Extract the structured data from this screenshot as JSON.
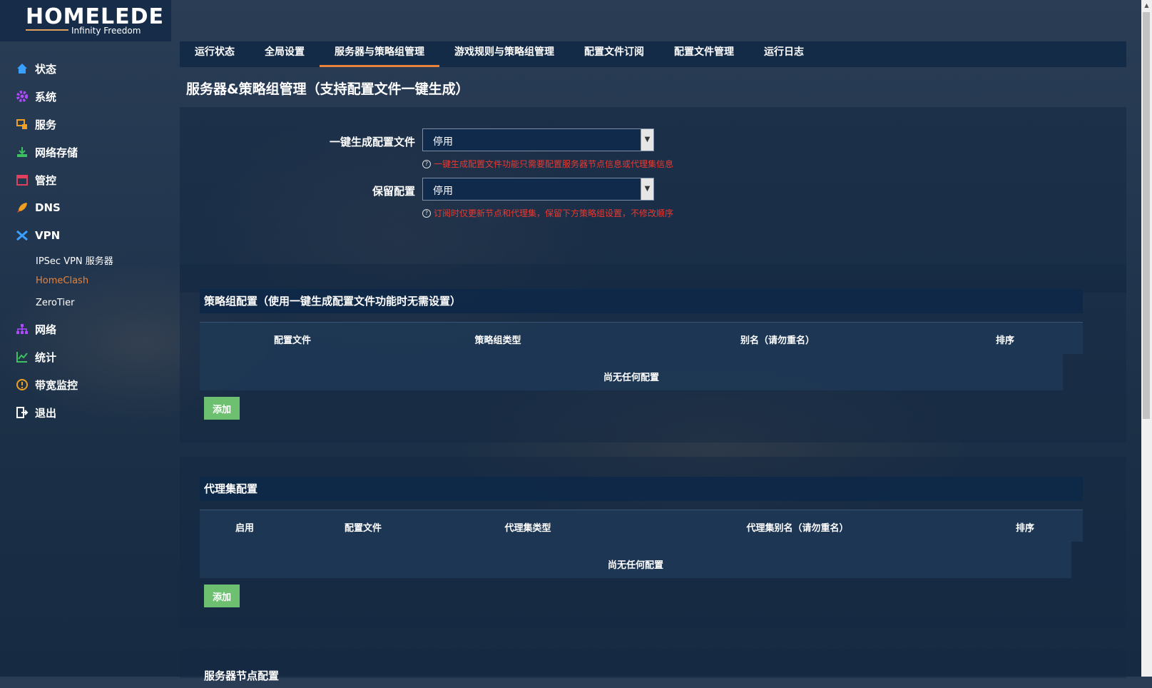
{
  "logo": {
    "brand": "HOMELEDE",
    "tagline": "Infinity Freedom"
  },
  "sidebar": {
    "items": [
      {
        "label": "状态",
        "icon": "home-icon",
        "color": "#3aa0ff"
      },
      {
        "label": "系统",
        "icon": "gear-icon",
        "color": "#b04aff"
      },
      {
        "label": "服务",
        "icon": "services-icon",
        "color": "#f0a020"
      },
      {
        "label": "网络存储",
        "icon": "storage-icon",
        "color": "#3cc060"
      },
      {
        "label": "管控",
        "icon": "calendar-icon",
        "color": "#e04060"
      },
      {
        "label": "DNS",
        "icon": "rocket-icon",
        "color": "#f0a020"
      },
      {
        "label": "VPN",
        "icon": "vpn-icon",
        "color": "#3aa0ff"
      },
      {
        "label": "网络",
        "icon": "network-icon",
        "color": "#b04aff"
      },
      {
        "label": "统计",
        "icon": "chart-icon",
        "color": "#3cc060"
      },
      {
        "label": "带宽监控",
        "icon": "bandwidth-icon",
        "color": "#f0a020"
      },
      {
        "label": "退出",
        "icon": "logout-icon",
        "color": "#ffffff"
      }
    ],
    "vpn_sub": [
      {
        "label": "IPSec VPN 服务器",
        "active": false
      },
      {
        "label": "HomeClash",
        "active": true
      },
      {
        "label": "ZeroTier",
        "active": false
      }
    ],
    "active_color": "#e8823a"
  },
  "tabs": [
    "运行状态",
    "全局设置",
    "服务器与策略组管理",
    "游戏规则与策略组管理",
    "配置文件订阅",
    "配置文件管理",
    "运行日志"
  ],
  "active_tab": "服务器与策略组管理",
  "page_title": "服务器&策略组管理（支持配置文件一键生成）",
  "form": {
    "generate": {
      "label": "一键生成配置文件",
      "value": "停用",
      "hint": "一键生成配置文件功能只需要配置服务器节点信息或代理集信息"
    },
    "keep": {
      "label": "保留配置",
      "value": "停用",
      "hint": "订阅时仅更新节点和代理集，保留下方策略组设置，不修改顺序"
    }
  },
  "policy_section": {
    "title": "策略组配置（使用一键生成配置文件功能时无需设置）",
    "columns": [
      "配置文件",
      "策略组类型",
      "别名（请勿重名）",
      "排序"
    ],
    "empty_text": "尚无任何配置",
    "add_label": "添加"
  },
  "proxy_section": {
    "title": "代理集配置",
    "columns": [
      "启用",
      "配置文件",
      "代理集类型",
      "代理集别名（请勿重名）",
      "排序"
    ],
    "empty_text": "尚无任何配置",
    "add_label": "添加"
  },
  "server_section": {
    "title": "服务器节点配置"
  },
  "colors": {
    "hint": "#e83a32",
    "add_button": "#6cc070",
    "accent": "#e8823a"
  }
}
